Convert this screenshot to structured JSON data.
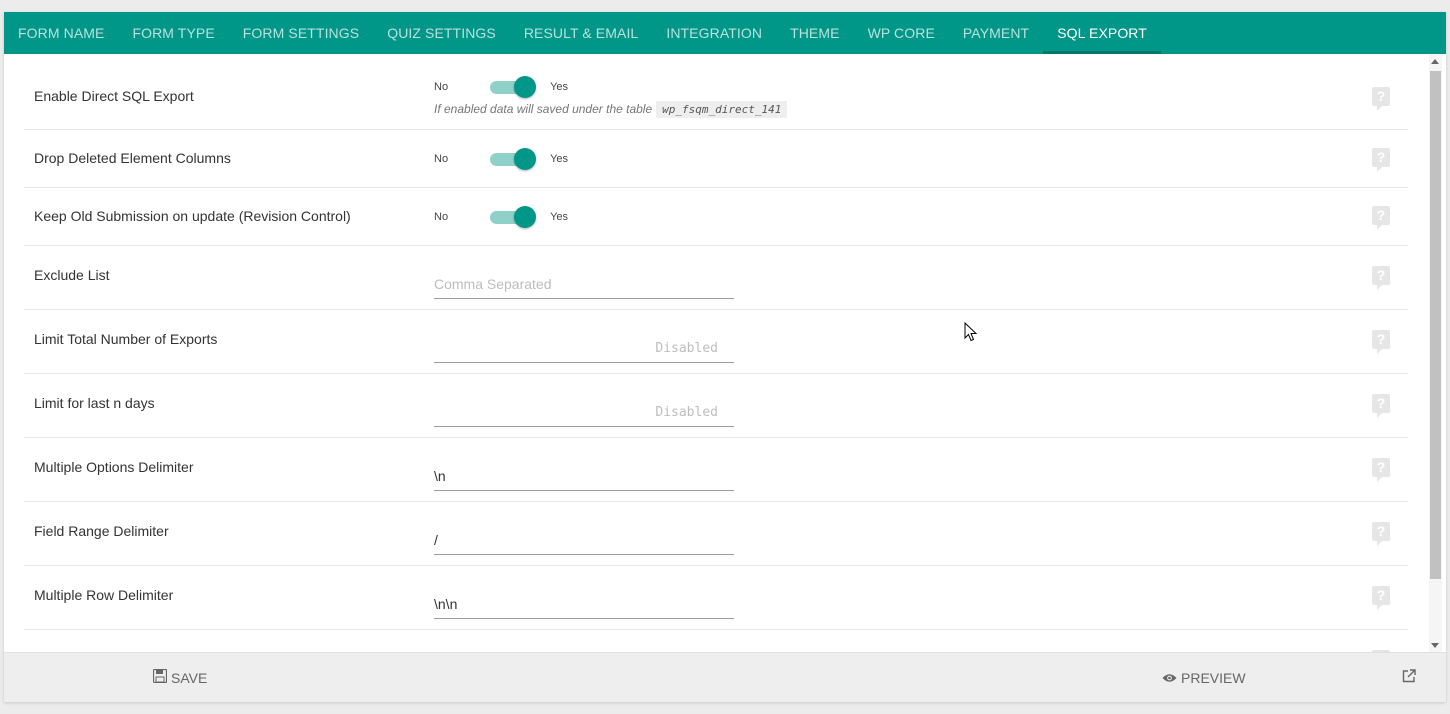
{
  "tabs": [
    {
      "label": "FORM NAME",
      "active": false
    },
    {
      "label": "FORM TYPE",
      "active": false
    },
    {
      "label": "FORM SETTINGS",
      "active": false
    },
    {
      "label": "QUIZ SETTINGS",
      "active": false
    },
    {
      "label": "RESULT & EMAIL",
      "active": false
    },
    {
      "label": "INTEGRATION",
      "active": false
    },
    {
      "label": "THEME",
      "active": false
    },
    {
      "label": "WP CORE",
      "active": false
    },
    {
      "label": "PAYMENT",
      "active": false
    },
    {
      "label": "SQL EXPORT",
      "active": true
    }
  ],
  "settings": {
    "enable_direct": {
      "label": "Enable Direct SQL Export",
      "no": "No",
      "yes": "Yes",
      "checked": true,
      "helper_text": "If enabled data will saved under the table",
      "helper_code": "wp_fsqm_direct_141"
    },
    "drop_deleted": {
      "label": "Drop Deleted Element Columns",
      "no": "No",
      "yes": "Yes",
      "checked": true
    },
    "keep_old": {
      "label": "Keep Old Submission on update (Revision Control)",
      "no": "No",
      "yes": "Yes",
      "checked": true
    },
    "exclude_list": {
      "label": "Exclude List",
      "value": "",
      "placeholder": "Comma Separated"
    },
    "limit_total": {
      "label": "Limit Total Number of Exports",
      "value": "",
      "placeholder": "Disabled"
    },
    "limit_days": {
      "label": "Limit for last n days",
      "value": "",
      "placeholder": "Disabled"
    },
    "multi_options": {
      "label": "Multiple Options Delimiter",
      "value": "\\n"
    },
    "field_range": {
      "label": "Field Range Delimiter",
      "value": "/"
    },
    "multi_row": {
      "label": "Multiple Row Delimiter",
      "value": "\\n\\n"
    }
  },
  "bottom": {
    "save_label": "SAVE",
    "preview_label": "PREVIEW"
  },
  "colors": {
    "accent": "#009688",
    "accent_dark": "#00796b",
    "toggle_track": "#8fd0c9"
  }
}
